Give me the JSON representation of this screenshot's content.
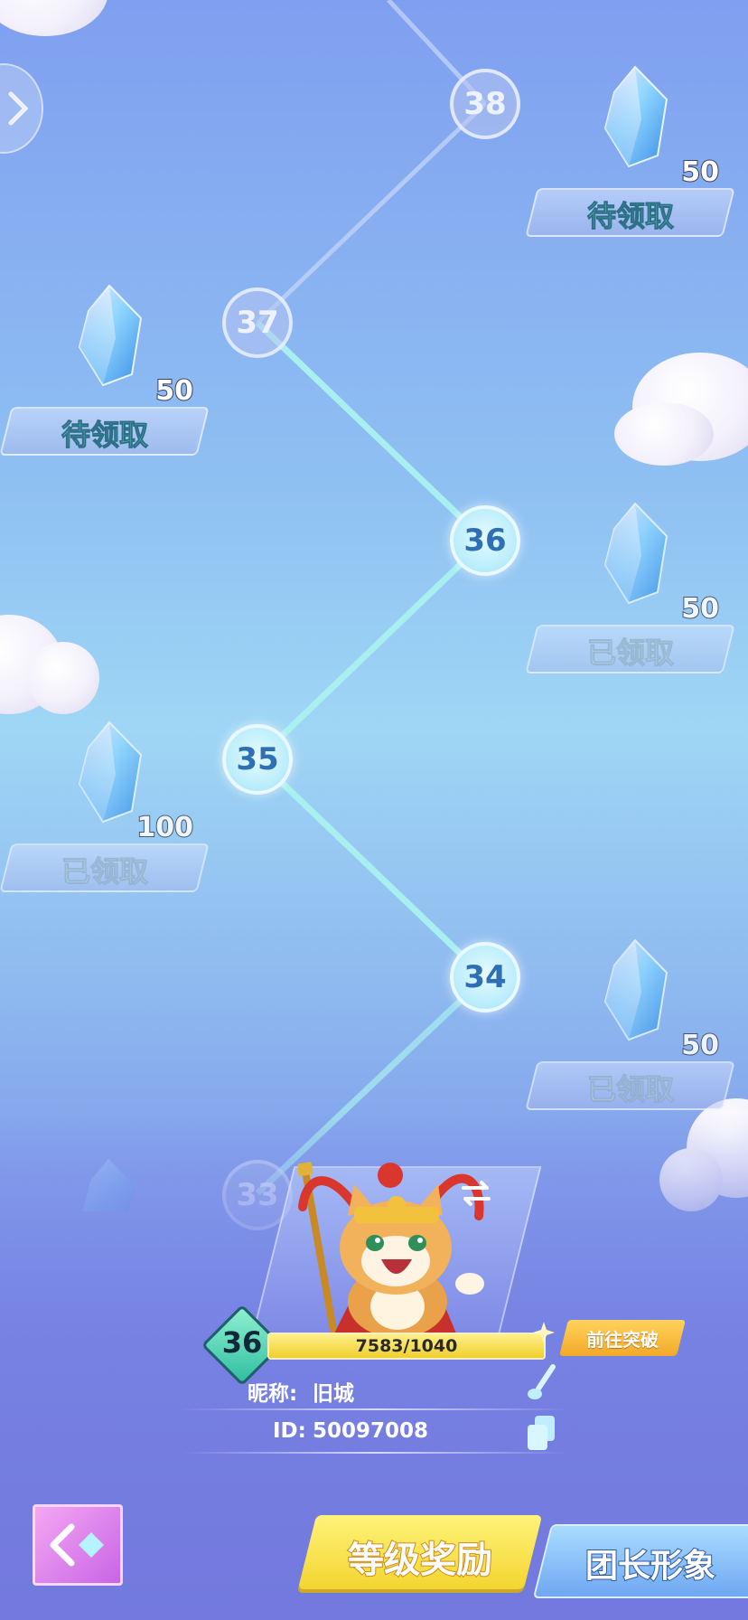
{
  "levels": [
    {
      "level": "38",
      "state": "locked",
      "reward_amount": "50",
      "reward_status": "待领取"
    },
    {
      "level": "37",
      "state": "locked",
      "reward_amount": "50",
      "reward_status": "待领取"
    },
    {
      "level": "36",
      "state": "active",
      "reward_amount": "50",
      "reward_status": "已领取"
    },
    {
      "level": "35",
      "state": "active",
      "reward_amount": "100",
      "reward_status": "已领取"
    },
    {
      "level": "34",
      "state": "active",
      "reward_amount": "50",
      "reward_status": "已领取"
    },
    {
      "level": "33",
      "state": "faded"
    }
  ],
  "player": {
    "level": "36",
    "exp_text": "7583/1040",
    "exp_fill": 1.0,
    "breakthrough_label": "前往突破",
    "nickname_label": "昵称:",
    "nickname": "旧城",
    "id_label": "ID:",
    "id_value": "50097008"
  },
  "tabs": {
    "level_rewards": "等级奖励",
    "leader_image": "团长形象"
  },
  "colors": {
    "accent_yellow": "#f7e04a",
    "pending_text": "#7af0d0",
    "node_active": "#b8ecfb"
  }
}
